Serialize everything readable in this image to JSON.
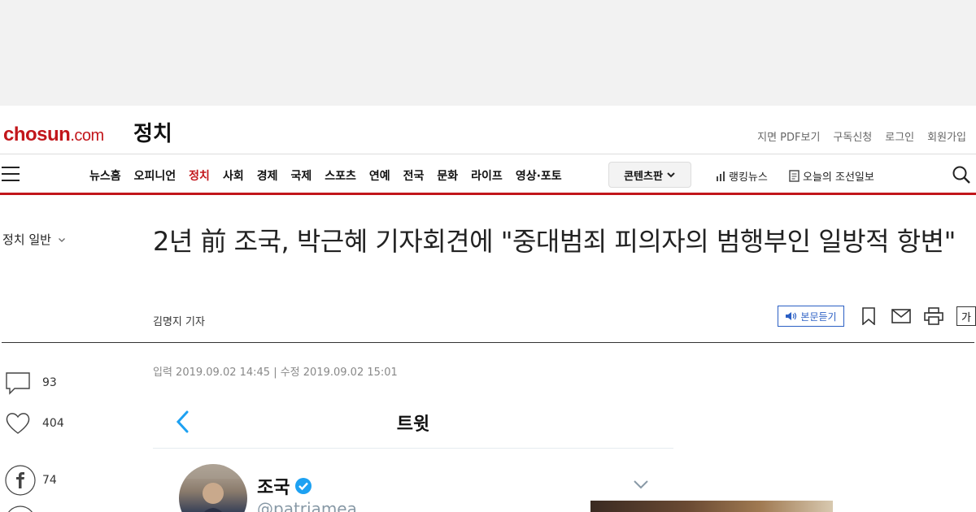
{
  "header": {
    "logo_main": "chosun",
    "logo_suffix": ".com",
    "section_title": "정치",
    "util_links": [
      "지면 PDF보기",
      "구독신청",
      "로그인",
      "회원가입"
    ]
  },
  "nav": {
    "items": [
      "뉴스홈",
      "오피니언",
      "정치",
      "사회",
      "경제",
      "국제",
      "스포츠",
      "연예",
      "전국",
      "문화",
      "라이프",
      "영상·포토"
    ],
    "active": "정치",
    "content_button": "콘텐츠판",
    "ranking": "랭킹뉴스",
    "today_paper": "오늘의 조선일보"
  },
  "sidebar": {
    "category": "정치 일반"
  },
  "article": {
    "headline": "2년 前 조국, 박근혜 기자회견에 \"중대범죄 피의자의 범행부인 일방적 항변\"",
    "byline": "김명지 기자",
    "listen_label": "본문듣기",
    "font_size_label": "가",
    "dateline": "입력 2019.09.02 14:45 | 수정 2019.09.02 15:01"
  },
  "social": {
    "comments": "93",
    "likes": "404",
    "facebook": "74"
  },
  "tweet": {
    "title": "트윗",
    "name": "조국",
    "handle": "@patriamea"
  },
  "colors": {
    "brand": "#c2161b",
    "listen_blue": "#2b5fc4",
    "twitter_blue": "#1da1f2"
  }
}
